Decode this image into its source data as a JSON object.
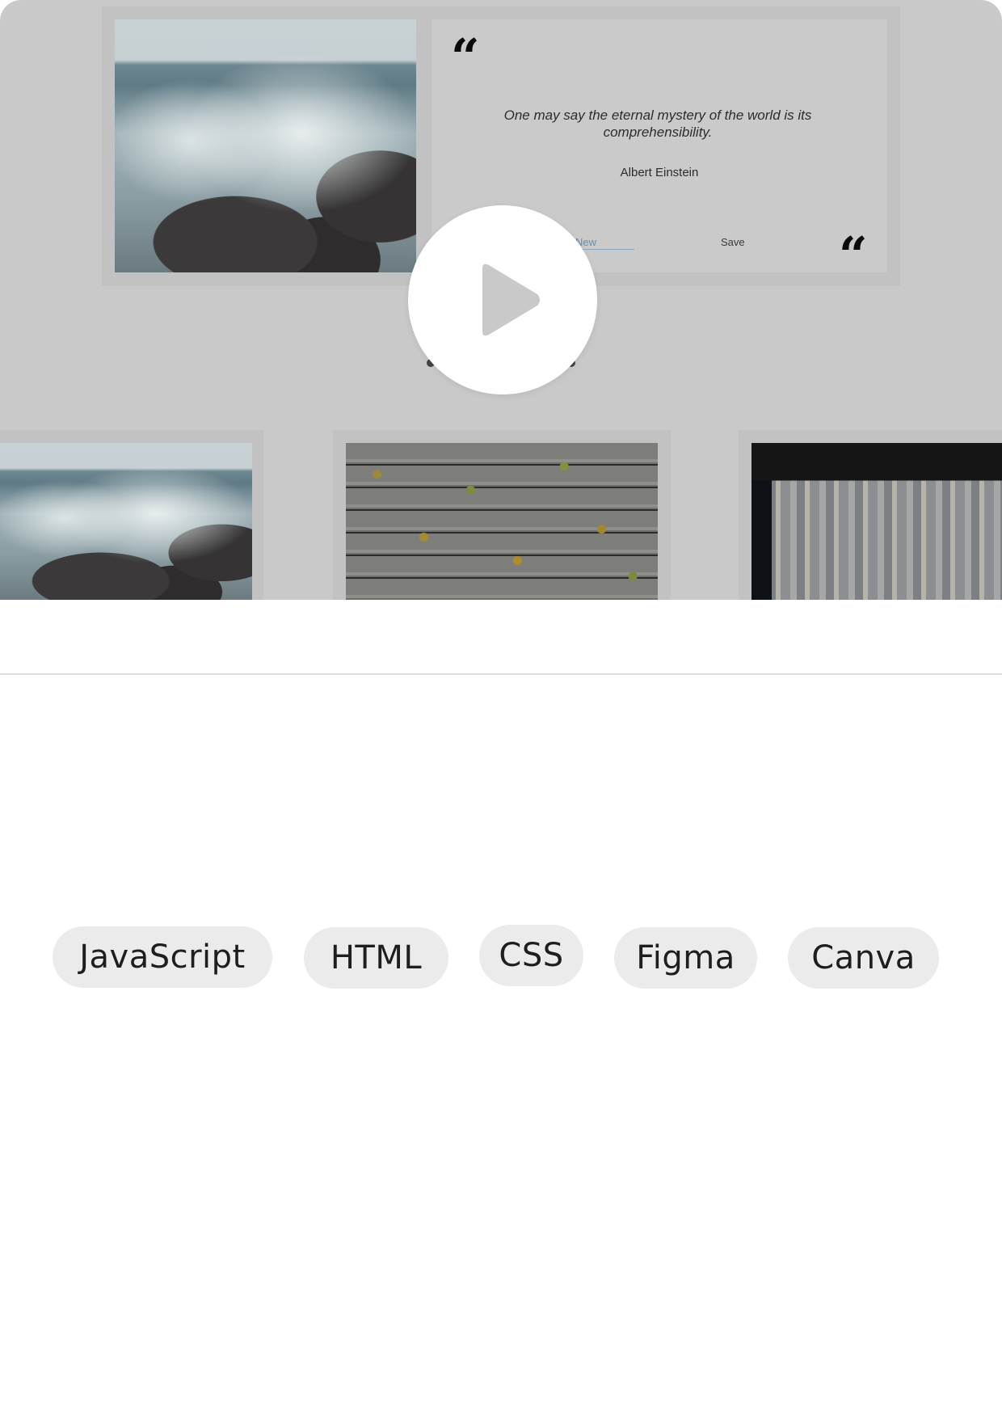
{
  "video": {
    "quote": {
      "text": "One may say the eternal mystery of the world is its comprehensibility.",
      "author": "Albert Einstein",
      "action_left": "New",
      "action_right": "Save",
      "quote_glyph": "“"
    },
    "play_icon": "play-icon",
    "photos": [
      "sea-waves-photo",
      "wooden-deck-leaves-photo",
      "city-underpass-photo"
    ]
  },
  "tags": [
    "JavaScript",
    "HTML",
    "CSS",
    "Figma",
    "Canva"
  ],
  "colors": {
    "overlay_gray": "#c9c9c9",
    "tag_bg": "#ebebeb",
    "divider": "#dcdcdc",
    "play_bg": "#ffffff",
    "play_glyph": "#c9c9c9"
  }
}
